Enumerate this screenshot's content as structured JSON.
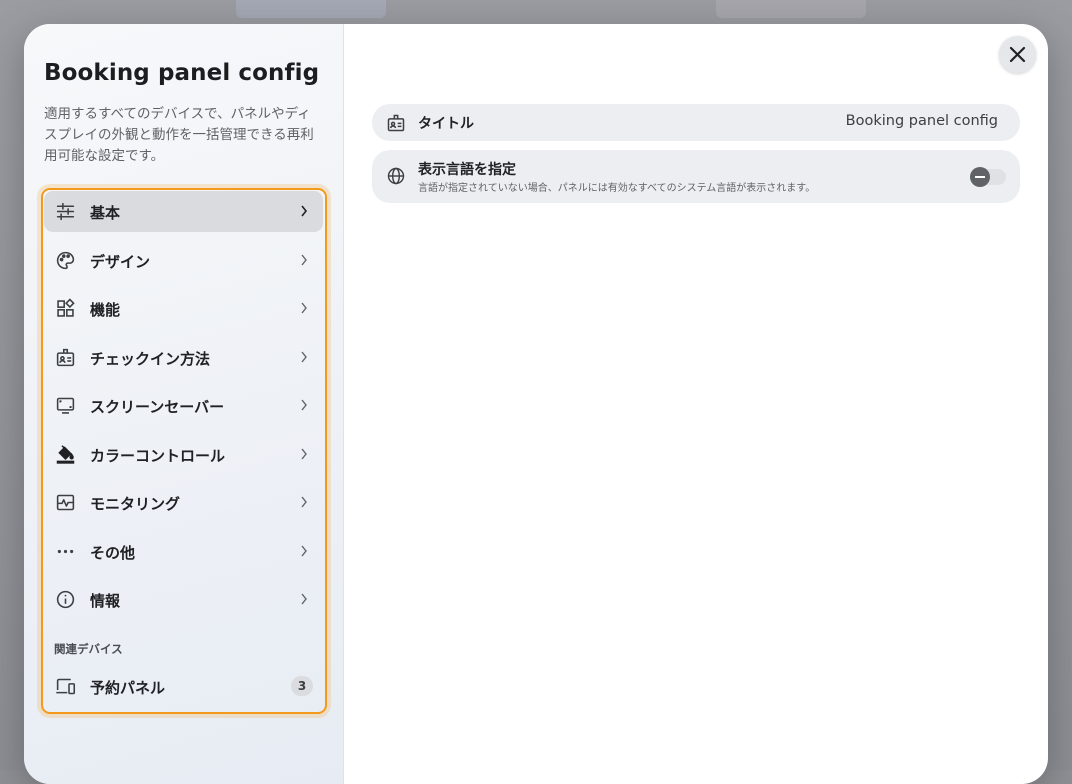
{
  "background": {
    "tab_left_color": "#a4a8b4",
    "tab_right_color": "#a6a6ac"
  },
  "sidebar": {
    "title": "Booking panel config",
    "description": "適用するすべてのデバイスで、パネルやディスプレイの外観と動作を一括管理できる再利用可能な設定です。",
    "items": [
      {
        "label": "基本",
        "icon": "sliders-icon",
        "active": true
      },
      {
        "label": "デザイン",
        "icon": "palette-icon"
      },
      {
        "label": "機能",
        "icon": "widgets-icon"
      },
      {
        "label": "チェックイン方法",
        "icon": "badge-icon"
      },
      {
        "label": "スクリーンセーバー",
        "icon": "monitor-icon"
      },
      {
        "label": "カラーコントロール",
        "icon": "paint-bucket-icon"
      },
      {
        "label": "モニタリング",
        "icon": "pulse-monitor-icon"
      },
      {
        "label": "その他",
        "icon": "more-dots-icon"
      },
      {
        "label": "情報",
        "icon": "info-icon"
      }
    ],
    "section_title": "関連デバイス",
    "related": [
      {
        "label": "予約パネル",
        "count": "3",
        "icon": "devices-icon"
      }
    ],
    "highlight_color": "#f39a1c"
  },
  "main": {
    "title_row": {
      "label": "タイトル",
      "value": "Booking panel config",
      "icon": "badge-icon"
    },
    "language_row": {
      "label": "表示言語を指定",
      "description": "言語が指定されていない場合、パネルには有効なすべてのシステム言語が表示されます。",
      "icon": "globe-icon",
      "toggle_on": false
    }
  },
  "close_icon": "close-icon"
}
